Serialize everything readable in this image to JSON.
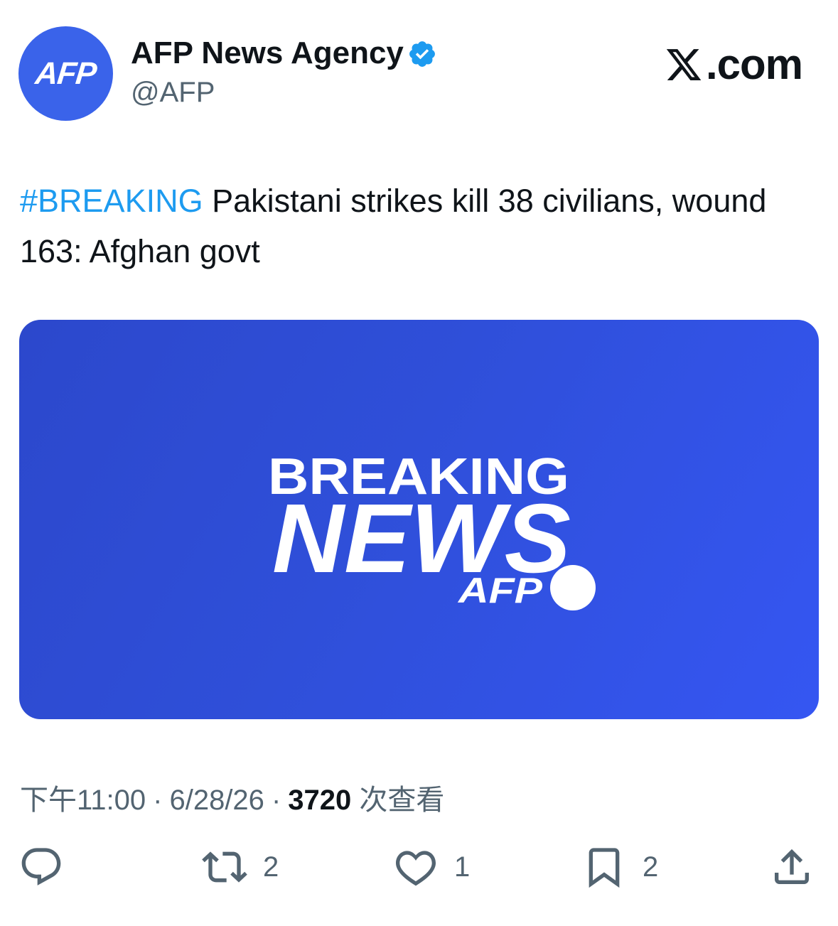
{
  "author": {
    "avatar_text": "AFP",
    "display_name": "AFP News Agency",
    "handle": "@AFP",
    "verified_icon": "verified-badge-icon",
    "verified_color": "#1d9bf0"
  },
  "brand": {
    "label": ".com",
    "icon": "x-logo-icon"
  },
  "tweet": {
    "hashtag": "#BREAKING",
    "text": " Pakistani strikes kill 38 civilians, wound 163: Afghan govt"
  },
  "media": {
    "headline_line1": "BREAKING",
    "headline_line2": "NEWS",
    "logo_text": "AFP",
    "background_color": "#2f4fd9"
  },
  "meta": {
    "time": "下午11:00",
    "sep1": "·",
    "date": "6/28/26",
    "sep2": "·",
    "views": "3720",
    "views_label": "次查看"
  },
  "actions": {
    "reply": {
      "icon": "reply-icon",
      "count": ""
    },
    "retweet": {
      "icon": "retweet-icon",
      "count": "2"
    },
    "like": {
      "icon": "heart-icon",
      "count": "1"
    },
    "bookmark": {
      "icon": "bookmark-icon",
      "count": "2"
    },
    "share": {
      "icon": "share-icon",
      "count": ""
    }
  },
  "colors": {
    "accent": "#1d9bf0",
    "avatar_bg": "#3a63ea",
    "secondary_text": "#536471",
    "primary_text": "#0f1419"
  }
}
